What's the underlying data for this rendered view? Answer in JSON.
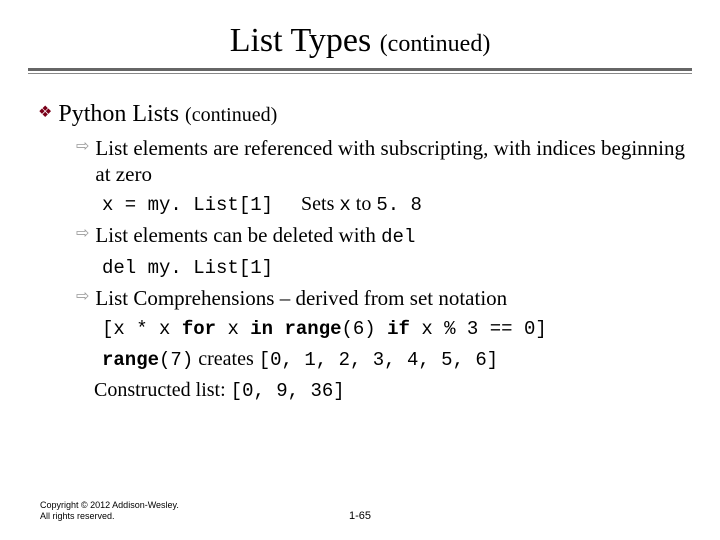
{
  "title": {
    "main": "List Types",
    "suffix": "(continued)"
  },
  "heading": {
    "main": "Python Lists",
    "suffix": "(continued)"
  },
  "bullets": {
    "b1": "List elements are referenced with subscripting, with indices beginning at zero",
    "b1_code": "x = my. List[1]",
    "b1_expl_prefix": "Sets ",
    "b1_expl_var": "x",
    "b1_expl_mid": " to ",
    "b1_expl_val": "5. 8",
    "b2_prefix": "List elements can be deleted with ",
    "b2_code": "del",
    "b2_sub_code": "del my. List[1]",
    "b3": "List Comprehensions – derived from set notation",
    "b3_code_pre": "[x * x ",
    "b3_code_kw1": "for",
    "b3_code_mid1": " x ",
    "b3_code_kw2": "in",
    "b3_code_mid2": " ",
    "b3_code_kw3": "range",
    "b3_code_paren1": "(6) ",
    "b3_code_kw4": "if",
    "b3_code_tail": " x % 3 == 0]",
    "b3_line2_kw": "range",
    "b3_line2_paren": "(7)",
    "b3_line2_text": " creates ",
    "b3_line2_list": "[0, 1, 2, 3, 4, 5, 6]",
    "b3_line3_text": "Constructed list: ",
    "b3_line3_list": "[0, 9, 36]"
  },
  "footer": {
    "copyright": "Copyright © 2012 Addison-Wesley. All rights reserved.",
    "page": "1-65"
  }
}
